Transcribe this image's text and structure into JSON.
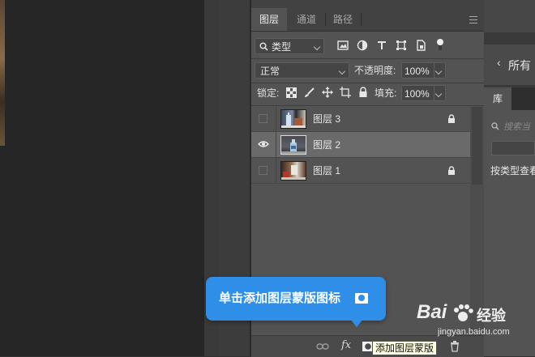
{
  "layers_panel": {
    "tabs": [
      {
        "label": "图层",
        "active": true
      },
      {
        "label": "通道",
        "active": false
      },
      {
        "label": "路径",
        "active": false
      }
    ],
    "filter": {
      "kind_label": "类型"
    },
    "blend_mode": "正常",
    "opacity_label": "不透明度:",
    "opacity_value": "100%",
    "lock_label": "锁定:",
    "fill_label": "填充:",
    "fill_value": "100%",
    "layers": [
      {
        "name": "图层 3",
        "visible": false,
        "locked": true,
        "selected": false
      },
      {
        "name": "图层 2",
        "visible": true,
        "locked": false,
        "selected": true
      },
      {
        "name": "图层 1",
        "visible": false,
        "locked": true,
        "selected": false
      }
    ],
    "bottom_toolbar": {
      "fx_label": "fx",
      "tooltip_hint": "添加图层蒙版"
    }
  },
  "callout": {
    "text": "单击添加图层蒙版图标"
  },
  "right_panel": {
    "all_label": "所有",
    "library_tab": "库",
    "search_placeholder": "搜索当",
    "view_by_type": "按类型查看"
  },
  "watermark": {
    "brand": "Bai",
    "brand_suffix": "经验",
    "url": "jingyan.baidu.com"
  },
  "colors": {
    "panel": "#535353",
    "selected_row": "#6a6a6a",
    "callout": "#2f8ee7",
    "canvas": "#262626"
  }
}
